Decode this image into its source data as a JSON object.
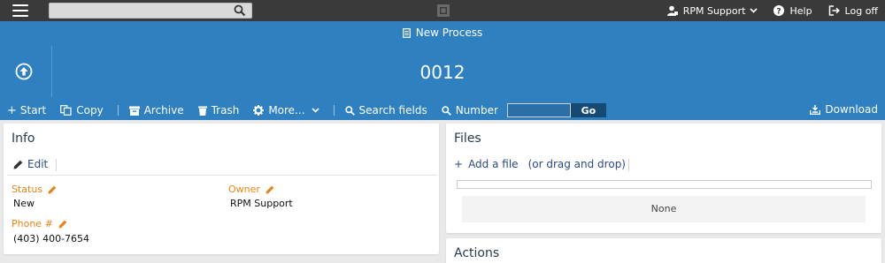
{
  "topbar": {
    "search": {
      "value": "",
      "placeholder": ""
    },
    "user_menu": "RPM Support",
    "help": "Help",
    "logoff": "Log off"
  },
  "header": {
    "title": "New Process",
    "record_number": "0012"
  },
  "toolbar": {
    "start": "Start",
    "copy": "Copy",
    "archive": "Archive",
    "trash": "Trash",
    "more": "More...",
    "search_fields": "Search fields",
    "number": "Number",
    "number_value": "",
    "go": "Go",
    "download": "Download"
  },
  "info": {
    "title": "Info",
    "edit": "Edit",
    "fields": [
      {
        "label": "Status",
        "value": "New"
      },
      {
        "label": "Owner",
        "value": "RPM Support"
      },
      {
        "label": "Phone #",
        "value": "(403) 400-7654"
      }
    ]
  },
  "files": {
    "title": "Files",
    "add_file": "Add a file",
    "drag_drop": "(or drag and drop)",
    "empty": "None"
  },
  "actions": {
    "title": "Actions"
  },
  "colors": {
    "header_blue": "#2f80c0",
    "topbar": "#3a3a3a",
    "field_label_orange": "#e8841a",
    "link_blue": "#2a4a80"
  }
}
